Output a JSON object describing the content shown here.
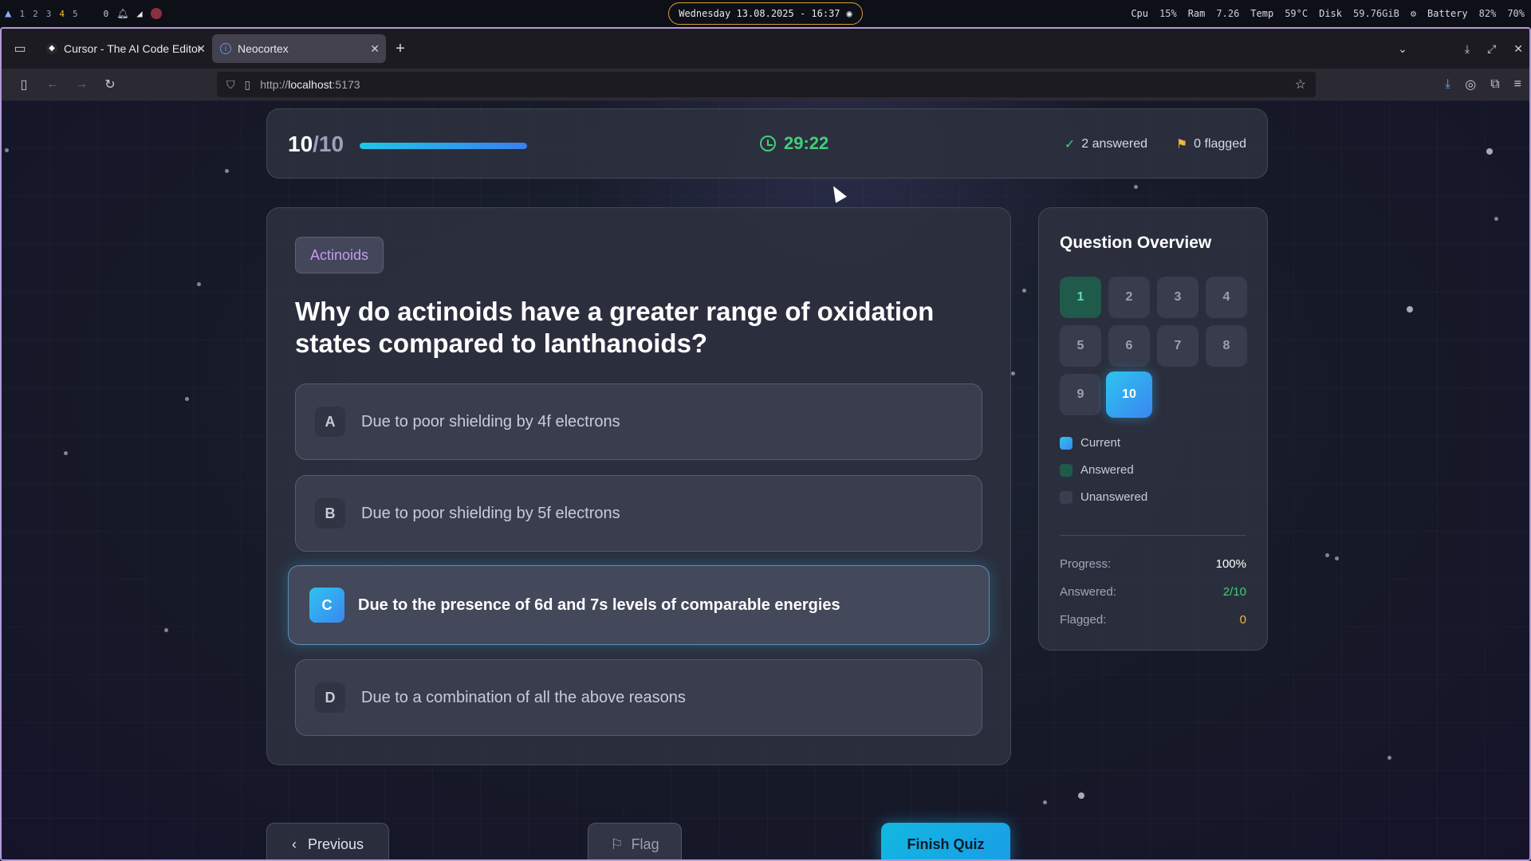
{
  "system_bar": {
    "workspaces": [
      "1",
      "2",
      "3",
      "4",
      "5"
    ],
    "notifications": "0",
    "datetime": "Wednesday 13.08.2025 - 16:37",
    "cpu_label": "Cpu",
    "cpu_value": "15%",
    "ram_label": "Ram",
    "ram_value": "7.26",
    "temp_label": "Temp",
    "temp_value": "59°C",
    "disk_label": "Disk",
    "disk_value": "59.76GiB",
    "battery_label": "Battery",
    "battery_value": "82%",
    "volume_value": "70%"
  },
  "browser": {
    "tabs": [
      {
        "title": "Cursor - The AI Code Editor",
        "active": false
      },
      {
        "title": "Neocortex",
        "active": true
      }
    ],
    "url_scheme": "http://",
    "url_host": "localhost",
    "url_rest": ":5173"
  },
  "quiz": {
    "current": "10",
    "total": "/10",
    "progress_fraction": 1.0,
    "timer": "29:22",
    "answered_text": "2 answered",
    "flagged_text": "0 flagged",
    "topic": "Actinoids",
    "question": "Why do actinoids have a greater range of oxidation states compared to lanthanoids?",
    "options": [
      {
        "letter": "A",
        "text": "Due to poor shielding by 4f electrons",
        "selected": false
      },
      {
        "letter": "B",
        "text": "Due to poor shielding by 5f electrons",
        "selected": false
      },
      {
        "letter": "C",
        "text": "Due to the presence of 6d and 7s levels of comparable energies",
        "selected": true
      },
      {
        "letter": "D",
        "text": "Due to a combination of all the above reasons",
        "selected": false
      }
    ],
    "buttons": {
      "previous": "Previous",
      "flag": "Flag",
      "finish": "Finish Quiz"
    }
  },
  "overview": {
    "title": "Question Overview",
    "questions": [
      {
        "num": "1",
        "state": "answered"
      },
      {
        "num": "2",
        "state": "unanswered"
      },
      {
        "num": "3",
        "state": "unanswered"
      },
      {
        "num": "4",
        "state": "unanswered"
      },
      {
        "num": "5",
        "state": "unanswered"
      },
      {
        "num": "6",
        "state": "unanswered"
      },
      {
        "num": "7",
        "state": "unanswered"
      },
      {
        "num": "8",
        "state": "unanswered"
      },
      {
        "num": "9",
        "state": "unanswered"
      },
      {
        "num": "10",
        "state": "current"
      }
    ],
    "legend": {
      "current": "Current",
      "answered": "Answered",
      "unanswered": "Unanswered"
    },
    "stats": {
      "progress_label": "Progress:",
      "progress_value": "100%",
      "answered_label": "Answered:",
      "answered_value": "2/10",
      "flagged_label": "Flagged:",
      "flagged_value": "0"
    }
  },
  "colors": {
    "accent_cyan": "#1ec8e8",
    "accent_blue": "#3a86f0",
    "answered_green": "#3fd07a",
    "flag_amber": "#f0b840",
    "topic_purple": "#c49cf0"
  }
}
